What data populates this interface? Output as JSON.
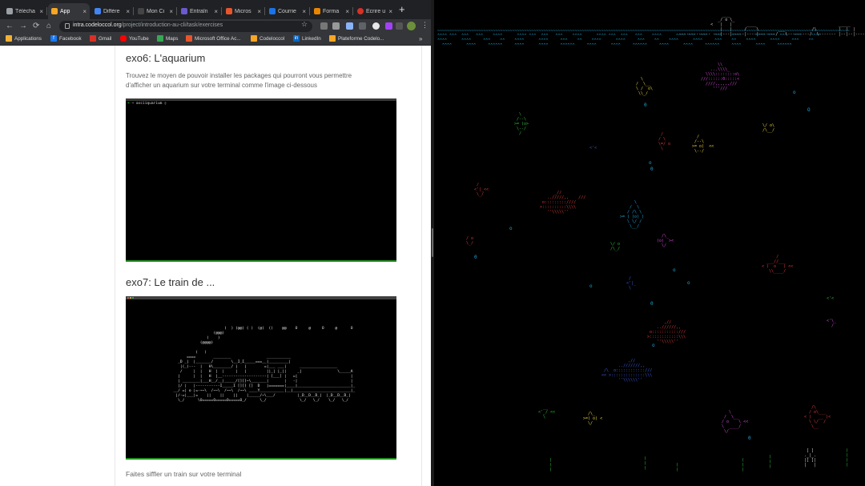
{
  "browser": {
    "tabs": [
      {
        "label": "Télécha",
        "color": "#9aa0a6"
      },
      {
        "label": "App",
        "color": "#f5a623",
        "active": true
      },
      {
        "label": "Différe",
        "color": "#4285f4"
      },
      {
        "label": "Mon Ci",
        "color": "#444444"
      },
      {
        "label": "Entraîn",
        "color": "#6a5acd"
      },
      {
        "label": "Micros",
        "color": "#e8552b"
      },
      {
        "label": "Courrie",
        "color": "#1a73e8"
      },
      {
        "label": "Forma",
        "color": "#ea8600"
      },
      {
        "label": "Écrire u",
        "color": "#d93025"
      }
    ],
    "new_tab": "+",
    "close_glyph": "×",
    "url_host": "intra.codeloccol.org",
    "url_path": "/project/introduction-au-cli/task/exercises",
    "nav": {
      "back": "←",
      "forward": "→",
      "reload": "⟳",
      "home": "⌂",
      "star": "☆",
      "menu": "⋮"
    },
    "bookmarks": [
      {
        "label": "Applications",
        "color": "#f2b134",
        "icon": "apps-grid-icon"
      },
      {
        "label": "Facebook",
        "color": "#1877f2",
        "icon": "facebook-icon"
      },
      {
        "label": "Gmail",
        "color": "#d93025",
        "icon": "gmail-icon"
      },
      {
        "label": "YouTube",
        "color": "#ff0000",
        "icon": "youtube-icon"
      },
      {
        "label": "Maps",
        "color": "#34a853",
        "icon": "maps-icon"
      },
      {
        "label": "Microsoft Office Ac...",
        "color": "#e8552b",
        "icon": "office-icon"
      },
      {
        "label": "Codeloccol",
        "color": "#f5a623",
        "icon": "codeloccol-icon"
      },
      {
        "label": "LinkedIn",
        "color": "#0a66c2",
        "icon": "linkedin-icon"
      },
      {
        "label": "Plateforme Codelo...",
        "color": "#f5a623",
        "icon": "codeloccol-icon"
      }
    ],
    "bookmarks_more": "»"
  },
  "content": {
    "exo6_title": "exo6: L'aquarium",
    "exo6_desc_line1": "Trouvez le moyen de pouvoir installer les packages qui pourront vous permettre",
    "exo6_desc_line2": "d'afficher un aquarium sur votre terminal comme l'image ci-dessous",
    "exo6_prompt_arrow": "➜",
    "exo6_prompt_cmd": "~ asciiquarium",
    "exo7_title": "exo7: Le train de ...",
    "exo7_desc": "Faites siffler un train sur votre terminal"
  },
  "colors": {
    "fish_green": "#2fbf3c",
    "fish_magenta": "#d04ad6",
    "fish_red": "#e03a3a",
    "fish_yellow": "#e8d23a",
    "fish_cyan": "#1ea5d8",
    "fish_blue": "#3a5ce0",
    "water": "#19a9d6"
  }
}
